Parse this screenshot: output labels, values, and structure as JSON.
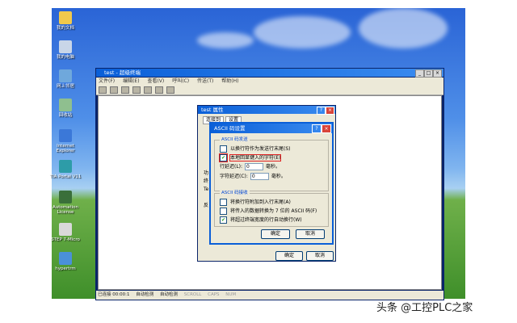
{
  "desktop": {
    "icons": [
      {
        "label": "我的文档",
        "icon": "documents-icon",
        "color": "#f2c94c"
      },
      {
        "label": "我的电脑",
        "icon": "computer-icon",
        "color": "#c9d6e8"
      },
      {
        "label": "网上邻居",
        "icon": "network-icon",
        "color": "#6fa8dc"
      },
      {
        "label": "回收站",
        "icon": "recycle-bin-icon",
        "color": "#8fbf8f"
      },
      {
        "label": "Internet Explorer",
        "icon": "ie-icon",
        "color": "#3b78d8"
      },
      {
        "label": "TIA Portal V11",
        "icon": "tia-icon",
        "color": "#2d9ca8"
      },
      {
        "label": "Automation License",
        "icon": "license-icon",
        "color": "#3a6f3a"
      },
      {
        "label": "STEP 7-Micro",
        "icon": "step7-icon",
        "color": "#d9d9d9"
      },
      {
        "label": "hypertrm",
        "icon": "hyperterminal-icon",
        "color": "#4a90d9"
      }
    ]
  },
  "terminal": {
    "title": "test - 超级终端",
    "menu": [
      "文件(F)",
      "编辑(E)",
      "查看(V)",
      "呼叫(C)",
      "传送(T)",
      "帮助(H)"
    ],
    "status": {
      "connection": "已连接 00:00:1",
      "detect1": "自动检测",
      "detect2": "自动检测",
      "scroll": "SCROLL",
      "caps": "CAPS",
      "num": "NUM"
    }
  },
  "properties": {
    "title": "test 属性",
    "tabs": [
      "连接到",
      "设置"
    ],
    "side_labels": [
      "功",
      "终",
      "Te",
      "反"
    ],
    "ok": "确定",
    "cancel": "取消"
  },
  "ascii_setup": {
    "title": "ASCII 码设置",
    "send_group": "ASCII 码发送",
    "send_opts": [
      {
        "label": "以换行符作为发送行末尾(S)",
        "checked": false
      },
      {
        "label": "本地回显键入的字符(E)",
        "checked": true
      }
    ],
    "line_delay": {
      "label": "行延迟(L):",
      "value": "0",
      "unit": "毫秒。"
    },
    "char_delay": {
      "label": "字符延迟(C):",
      "value": "0",
      "unit": "毫秒。"
    },
    "recv_group": "ASCII 码接收",
    "recv_opts": [
      {
        "label": "将换行符附加到入行末尾(A)",
        "checked": false
      },
      {
        "label": "将传入的数据转换为 7 位的 ASCII 码(F)",
        "checked": false
      },
      {
        "label": "将超过终端宽度的行自动换行(W)",
        "checked": true
      }
    ],
    "ok": "确定",
    "cancel": "取消"
  },
  "watermark": "头条 @工控PLC之家"
}
